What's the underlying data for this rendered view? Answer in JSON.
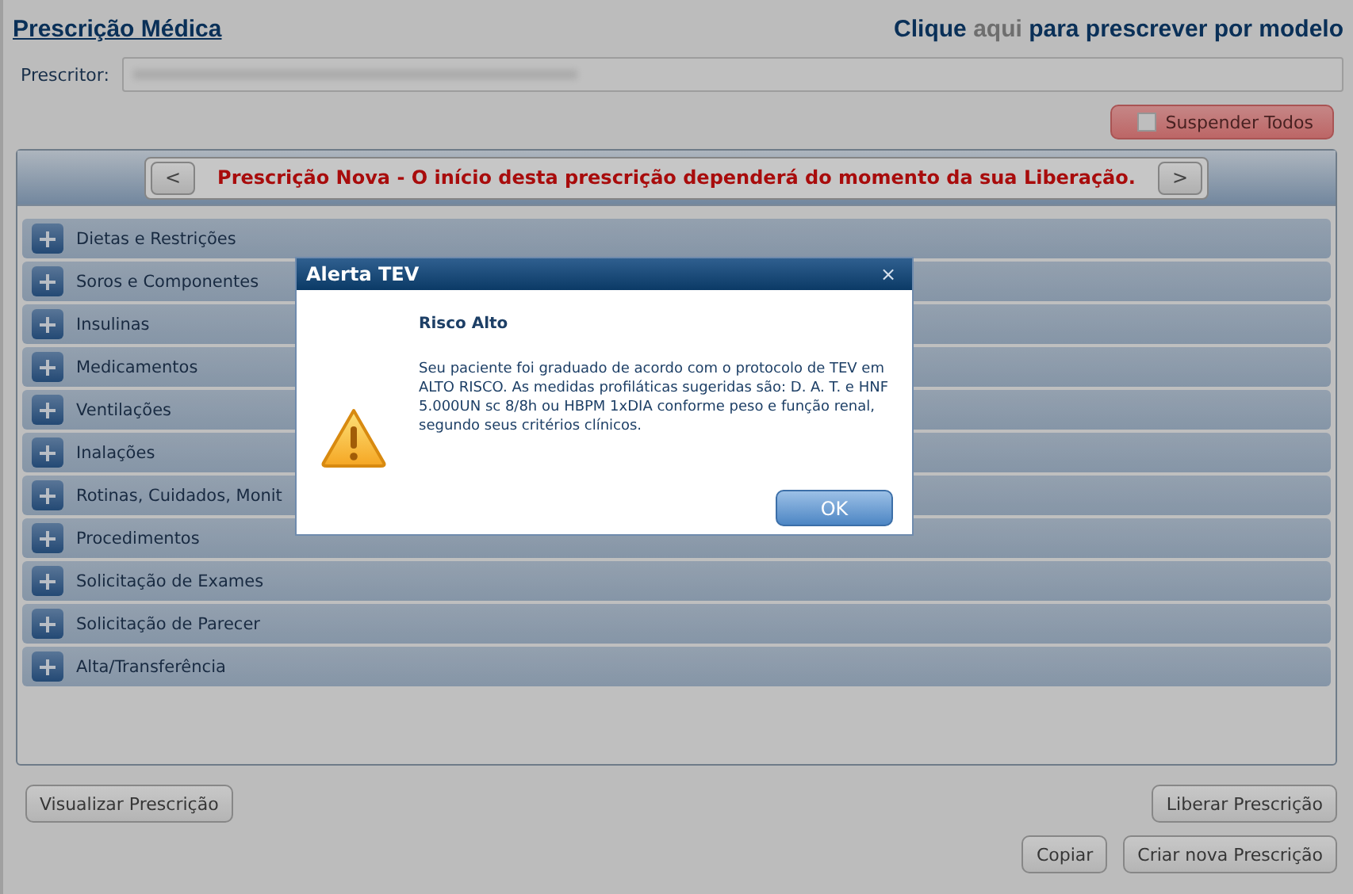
{
  "header": {
    "title": "Prescrição Médica",
    "model_link_before": "Clique",
    "model_link": "aqui",
    "model_link_after": "para prescrever por modelo"
  },
  "prescriber": {
    "label": "Prescritor:"
  },
  "suspend_all": {
    "label": "Suspender Todos",
    "checked": false
  },
  "banner": {
    "prev": "<",
    "message": "Prescrição Nova - O início desta prescrição dependerá do momento da sua Liberação.",
    "next": ">"
  },
  "sections": [
    {
      "label": "Dietas e Restrições",
      "expanded": false
    },
    {
      "label": "Soros e Componentes",
      "expanded": false
    },
    {
      "label": "Insulinas",
      "expanded": false
    },
    {
      "label": "Medicamentos",
      "expanded": false
    },
    {
      "label": "Ventilações",
      "expanded": false
    },
    {
      "label": "Inalações",
      "expanded": false
    },
    {
      "label": "Rotinas, Cuidados, Monit",
      "expanded": false
    },
    {
      "label": "Procedimentos",
      "expanded": false
    },
    {
      "label": "Solicitação de Exames",
      "expanded": false
    },
    {
      "label": "Solicitação de Parecer",
      "expanded": false
    },
    {
      "label": "Alta/Transferência",
      "expanded": false
    }
  ],
  "buttons": {
    "view": "Visualizar Prescrição",
    "release": "Liberar Prescrição",
    "copy": "Copiar",
    "new": "Criar nova Prescrição"
  },
  "dialog": {
    "title": "Alerta TEV",
    "close": "×",
    "heading": "Risco Alto",
    "message": "Seu paciente foi graduado de acordo com o protocolo de TEV em ALTO RISCO. As medidas profiláticas sugeridas são: D. A. T. e HNF 5.000UN sc 8/8h ou HBPM 1xDIA conforme peso e função renal, segundo seus critérios clínicos.",
    "ok": "OK"
  }
}
